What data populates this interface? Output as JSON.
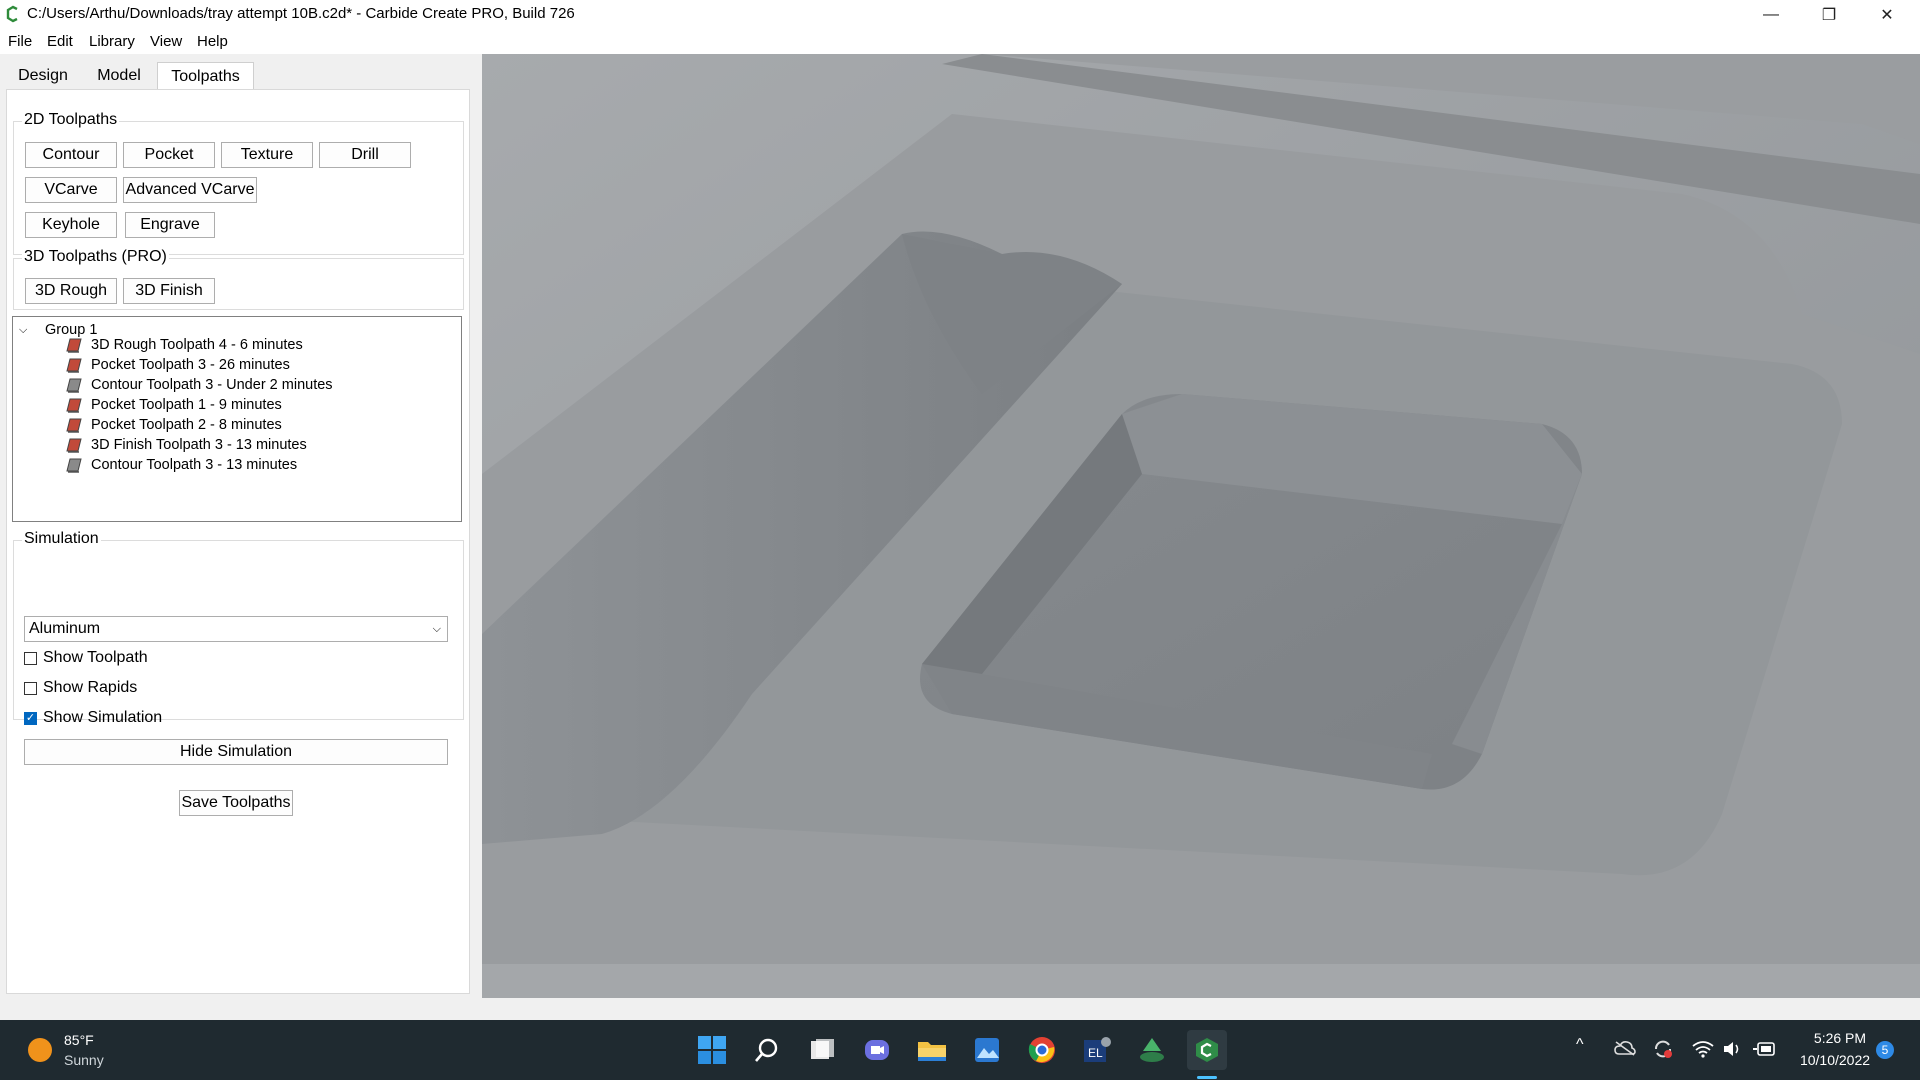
{
  "window": {
    "title": "C:/Users/Arthu/Downloads/tray attempt 10B.c2d* - Carbide Create PRO, Build 726",
    "minimize_glyph": "—",
    "restore_glyph": "❐",
    "close_glyph": "✕"
  },
  "menu": [
    "File",
    "Edit",
    "Library",
    "View",
    "Help"
  ],
  "tabs": [
    {
      "label": "Design",
      "active": false
    },
    {
      "label": "Model",
      "active": false
    },
    {
      "label": "Toolpaths",
      "active": true
    }
  ],
  "toolpaths_2d": {
    "title": "2D Toolpaths",
    "buttons": [
      "Contour",
      "Pocket",
      "Texture",
      "Drill",
      "VCarve",
      "Advanced VCarve",
      "Keyhole",
      "Engrave"
    ]
  },
  "toolpaths_3d": {
    "title": "3D Toolpaths (PRO)",
    "buttons": [
      "3D Rough",
      "3D Finish"
    ]
  },
  "tree": {
    "group_label": "Group 1",
    "expand_glyph": "⌵",
    "items": [
      "3D Rough Toolpath 4 - 6 minutes",
      "Pocket Toolpath 3 - 26 minutes",
      "Contour Toolpath 3 - Under 2 minutes",
      "Pocket Toolpath 1 - 9 minutes",
      "Pocket Toolpath 2 - 8 minutes",
      "3D Finish Toolpath 3 - 13 minutes",
      "Contour Toolpath 3 - 13 minutes"
    ]
  },
  "simulation": {
    "title": "Simulation",
    "material": "Aluminum",
    "dropdown_glyph": "⌵",
    "options": [
      {
        "label": "Show Toolpath",
        "checked": false
      },
      {
        "label": "Show Rapids",
        "checked": false
      },
      {
        "label": "Show Simulation",
        "checked": true
      }
    ],
    "hide_button": "Hide Simulation",
    "check_glyph": "✓"
  },
  "save_button": "Save Toolpaths",
  "taskbar": {
    "weather_temp": "85°F",
    "weather_desc": "Sunny",
    "time": "5:26 PM",
    "date": "10/10/2022",
    "notification_count": "5",
    "tray_up_glyph": "^"
  },
  "colors": {
    "accent": "#0067c0",
    "taskbar": "#1f2a30",
    "viewport_material": "#9a9ea2"
  }
}
